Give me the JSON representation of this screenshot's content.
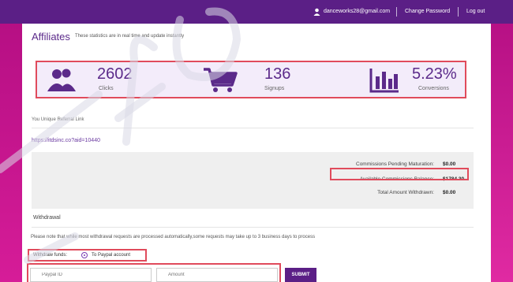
{
  "header": {
    "user_email": "danceworks28@gmail.com",
    "change_password": "Change Password",
    "logout": "Log out"
  },
  "page": {
    "title": "Affiliates",
    "subtitle": "These statistics are in real time and update instantly"
  },
  "stats": [
    {
      "value": "2602",
      "label": "Clicks",
      "icon": "users-icon"
    },
    {
      "value": "136",
      "label": "Signups",
      "icon": "cart-icon"
    },
    {
      "value": "5.23%",
      "label": "Conversions",
      "icon": "bar-chart-icon"
    }
  ],
  "referral": {
    "label": "You Unique Referral Link",
    "link": "https://itdsinc.co?aid=10440"
  },
  "commissions": {
    "pending_label": "Commissions Pending Maturation:",
    "pending_value": "$0.00",
    "available_label": "Available Commissions Balance:",
    "available_value": "$1784.30",
    "withdrawn_label": "Total Amount Withdrawn:",
    "withdrawn_value": "$0.00"
  },
  "withdrawal": {
    "heading": "Withdrawal",
    "note": "Please note that while most withdrawal requests are processed automatically,some requests may take up to 3 business days to process",
    "funds_label": "Withdraw funds:",
    "option_label": "To Paypal account",
    "paypal_placeholder": "Paypal ID",
    "amount_placeholder": "Amount",
    "submit_label": "SUBMIT"
  },
  "colors": {
    "accent": "#5b1f86",
    "highlight_border": "#e04b5c",
    "background": "#c9168f"
  }
}
